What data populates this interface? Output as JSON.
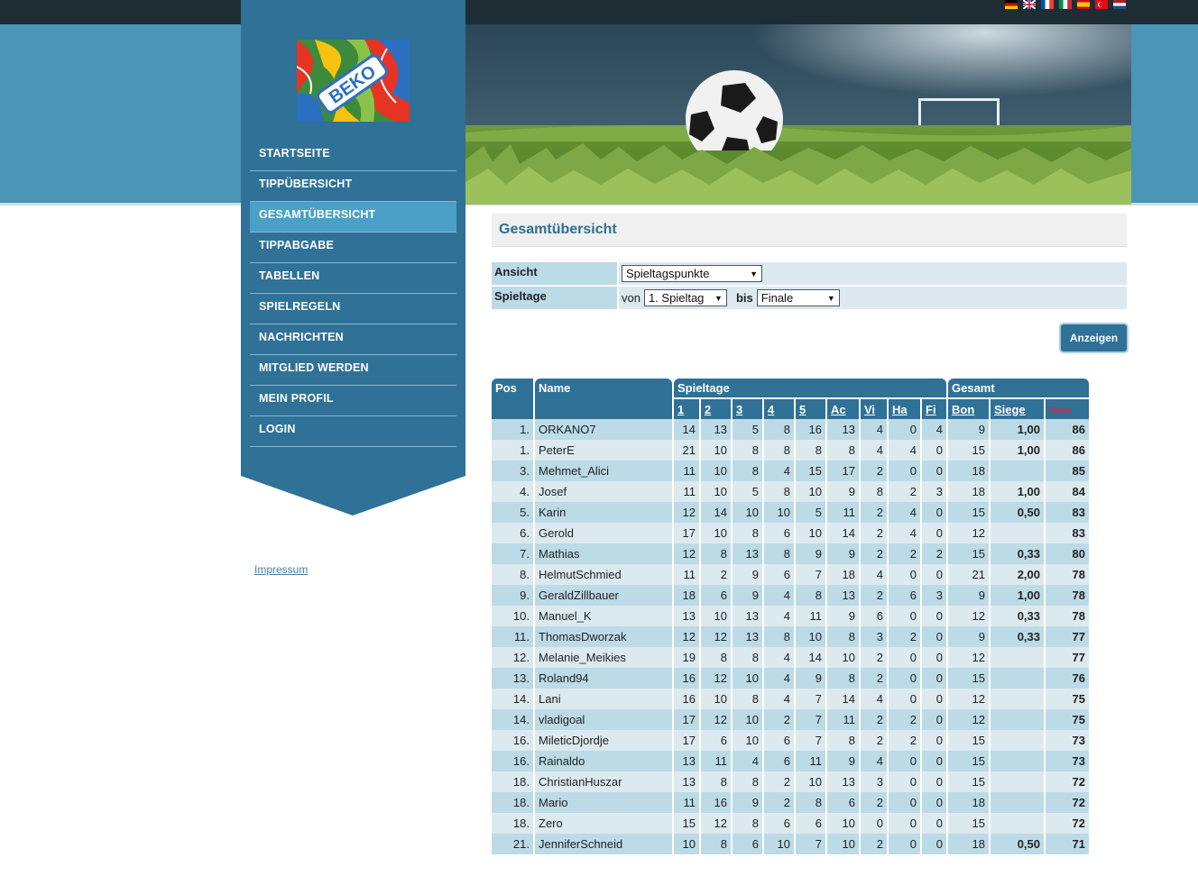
{
  "nav": {
    "items": [
      "STARTSEITE",
      "TIPPÜBERSICHT",
      "GESAMTÜBERSICHT",
      "TIPPABGABE",
      "TABELLEN",
      "SPIELREGELN",
      "NACHRICHTEN",
      "MITGLIED WERDEN",
      "MEIN PROFIL",
      "LOGIN"
    ],
    "active": "GESAMTÜBERSICHT"
  },
  "logo_text": "BEKO",
  "footer": {
    "impressum": "Impressum"
  },
  "page": {
    "title": "Gesamtübersicht"
  },
  "filter": {
    "ansicht_label": "Ansicht",
    "ansicht_value": "Spieltagspunkte",
    "spieltage_label": "Spieltage",
    "von_label": "von",
    "von_value": "1. Spieltag",
    "bis_label": "bis",
    "bis_value": "Finale",
    "submit_label": "Anzeigen"
  },
  "table": {
    "group_headers": {
      "pos": "Pos",
      "name": "Name",
      "spieltage": "Spieltage",
      "gesamt": "Gesamt"
    },
    "sub_headers": [
      "1",
      "2",
      "3",
      "4",
      "5",
      "Ac",
      "Vi",
      "Ha",
      "Fi",
      "Bon",
      "Siege",
      "Ges"
    ],
    "rows": [
      {
        "pos": "1.",
        "name": "ORKANO7",
        "d": [
          "14",
          "13",
          "5",
          "8",
          "16",
          "13",
          "4",
          "0",
          "4"
        ],
        "bon": "9",
        "siege": "1,00",
        "ges": "86"
      },
      {
        "pos": "1.",
        "name": "PeterE",
        "d": [
          "21",
          "10",
          "8",
          "8",
          "8",
          "8",
          "4",
          "4",
          "0"
        ],
        "bon": "15",
        "siege": "1,00",
        "ges": "86"
      },
      {
        "pos": "3.",
        "name": "Mehmet_Alici",
        "d": [
          "11",
          "10",
          "8",
          "4",
          "15",
          "17",
          "2",
          "0",
          "0"
        ],
        "bon": "18",
        "siege": "",
        "ges": "85"
      },
      {
        "pos": "4.",
        "name": "Josef",
        "d": [
          "11",
          "10",
          "5",
          "8",
          "10",
          "9",
          "8",
          "2",
          "3"
        ],
        "bon": "18",
        "siege": "1,00",
        "ges": "84"
      },
      {
        "pos": "5.",
        "name": "Karin",
        "d": [
          "12",
          "14",
          "10",
          "10",
          "5",
          "11",
          "2",
          "4",
          "0"
        ],
        "bon": "15",
        "siege": "0,50",
        "ges": "83"
      },
      {
        "pos": "6.",
        "name": "Gerold",
        "d": [
          "17",
          "10",
          "8",
          "6",
          "10",
          "14",
          "2",
          "4",
          "0"
        ],
        "bon": "12",
        "siege": "",
        "ges": "83"
      },
      {
        "pos": "7.",
        "name": "Mathias",
        "d": [
          "12",
          "8",
          "13",
          "8",
          "9",
          "9",
          "2",
          "2",
          "2"
        ],
        "bon": "15",
        "siege": "0,33",
        "ges": "80"
      },
      {
        "pos": "8.",
        "name": "HelmutSchmied",
        "d": [
          "11",
          "2",
          "9",
          "6",
          "7",
          "18",
          "4",
          "0",
          "0"
        ],
        "bon": "21",
        "siege": "2,00",
        "ges": "78"
      },
      {
        "pos": "9.",
        "name": "GeraldZillbauer",
        "d": [
          "18",
          "6",
          "9",
          "4",
          "8",
          "13",
          "2",
          "6",
          "3"
        ],
        "bon": "9",
        "siege": "1,00",
        "ges": "78"
      },
      {
        "pos": "10.",
        "name": "Manuel_K",
        "d": [
          "13",
          "10",
          "13",
          "4",
          "11",
          "9",
          "6",
          "0",
          "0"
        ],
        "bon": "12",
        "siege": "0,33",
        "ges": "78"
      },
      {
        "pos": "11.",
        "name": "ThomasDworzak",
        "d": [
          "12",
          "12",
          "13",
          "8",
          "10",
          "8",
          "3",
          "2",
          "0"
        ],
        "bon": "9",
        "siege": "0,33",
        "ges": "77"
      },
      {
        "pos": "12.",
        "name": "Melanie_Meikies",
        "d": [
          "19",
          "8",
          "8",
          "4",
          "14",
          "10",
          "2",
          "0",
          "0"
        ],
        "bon": "12",
        "siege": "",
        "ges": "77"
      },
      {
        "pos": "13.",
        "name": "Roland94",
        "d": [
          "16",
          "12",
          "10",
          "4",
          "9",
          "8",
          "2",
          "0",
          "0"
        ],
        "bon": "15",
        "siege": "",
        "ges": "76"
      },
      {
        "pos": "14.",
        "name": "Lani",
        "d": [
          "16",
          "10",
          "8",
          "4",
          "7",
          "14",
          "4",
          "0",
          "0"
        ],
        "bon": "12",
        "siege": "",
        "ges": "75"
      },
      {
        "pos": "14.",
        "name": "vladigoal",
        "d": [
          "17",
          "12",
          "10",
          "2",
          "7",
          "11",
          "2",
          "2",
          "0"
        ],
        "bon": "12",
        "siege": "",
        "ges": "75"
      },
      {
        "pos": "16.",
        "name": "MileticDjordje",
        "d": [
          "17",
          "6",
          "10",
          "6",
          "7",
          "8",
          "2",
          "2",
          "0"
        ],
        "bon": "15",
        "siege": "",
        "ges": "73"
      },
      {
        "pos": "16.",
        "name": "Rainaldo",
        "d": [
          "13",
          "11",
          "4",
          "6",
          "11",
          "9",
          "4",
          "0",
          "0"
        ],
        "bon": "15",
        "siege": "",
        "ges": "73"
      },
      {
        "pos": "18.",
        "name": "ChristianHuszar",
        "d": [
          "13",
          "8",
          "8",
          "2",
          "10",
          "13",
          "3",
          "0",
          "0"
        ],
        "bon": "15",
        "siege": "",
        "ges": "72"
      },
      {
        "pos": "18.",
        "name": "Mario",
        "d": [
          "11",
          "16",
          "9",
          "2",
          "8",
          "6",
          "2",
          "0",
          "0"
        ],
        "bon": "18",
        "siege": "",
        "ges": "72"
      },
      {
        "pos": "18.",
        "name": "Zero",
        "d": [
          "15",
          "12",
          "8",
          "6",
          "6",
          "10",
          "0",
          "0",
          "0"
        ],
        "bon": "15",
        "siege": "",
        "ges": "72"
      },
      {
        "pos": "21.",
        "name": "JenniferSchneid",
        "d": [
          "10",
          "8",
          "6",
          "10",
          "7",
          "10",
          "2",
          "0",
          "0"
        ],
        "bon": "18",
        "siege": "0,50",
        "ges": "71"
      }
    ]
  },
  "colors": {
    "primary": "#2f7197",
    "band": "#4a95b8",
    "row_dark": "#bcdbe7",
    "row_light": "#dceaf0",
    "ges_header": "#e23333"
  },
  "flags": [
    "german-flag-icon",
    "uk-flag-icon",
    "french-flag-icon",
    "italian-flag-icon",
    "spanish-flag-icon",
    "turkish-flag-icon",
    "dutch-flag-icon"
  ]
}
